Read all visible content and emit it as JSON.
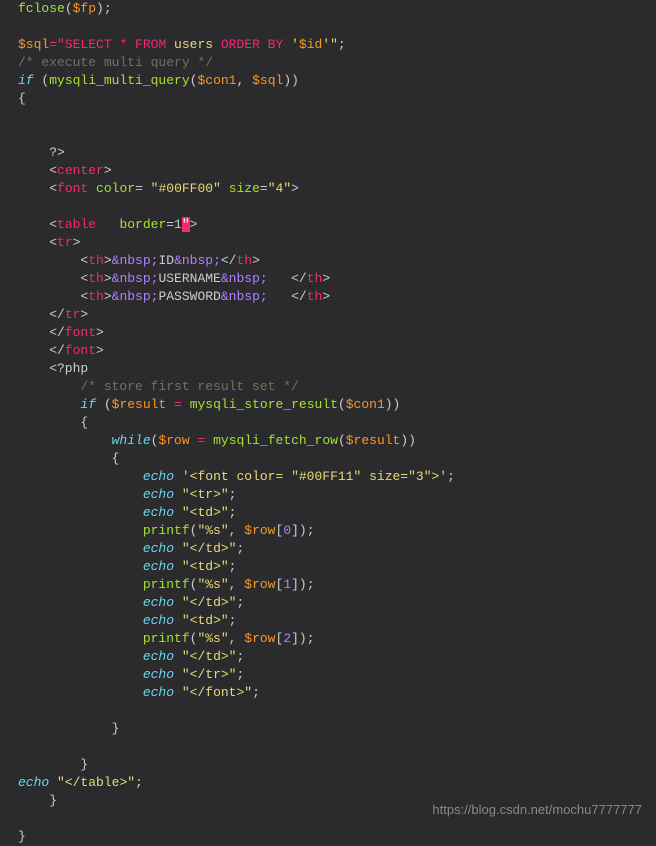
{
  "watermark": "https://blog.csdn.net/mochu7777777",
  "code": {
    "l01a": "fclose",
    "l01b": "(",
    "l01c": "$fp",
    "l01d": ");",
    "l03a": "$sql",
    "l03b": "=",
    "l03c": "\"SELECT * FROM",
    "l03d": " users ",
    "l03e": "ORDER BY",
    "l03f": " '",
    "l03g": "$id",
    "l03h": "'\"",
    "l03i": ";",
    "l04": "/* execute multi query */",
    "l05a": "if",
    "l05b": " (",
    "l05c": "mysqli_multi_query",
    "l05d": "(",
    "l05e": "$con1",
    "l05f": ", ",
    "l05g": "$sql",
    "l05h": "))",
    "l06": "{",
    "l09": "    ?>",
    "l10a": "    <",
    "l10b": "center",
    "l10c": ">",
    "l11a": "    <",
    "l11b": "font",
    "l11c": " ",
    "l11d": "color",
    "l11e": "= ",
    "l11f": "\"#00FF00\"",
    "l11g": " ",
    "l11h": "size",
    "l11i": "=",
    "l11j": "\"4\"",
    "l11k": ">",
    "l13a": "    <",
    "l13b": "table",
    "l13c": "   ",
    "l13d": "border",
    "l13e": "=1",
    "l13f": "\"",
    "l13g": ">",
    "l14a": "    <",
    "l14b": "tr",
    "l14c": ">",
    "l15a": "        <",
    "l15b": "th",
    "l15c": ">",
    "l15d": "&nbsp;",
    "l15e": "ID",
    "l15f": "&nbsp;",
    "l15g": "</",
    "l15h": "th",
    "l15i": ">",
    "l16a": "        <",
    "l16b": "th",
    "l16c": ">",
    "l16d": "&nbsp;",
    "l16e": "USERNAME",
    "l16f": "&nbsp;",
    "l16g": "   </",
    "l16h": "th",
    "l16i": ">",
    "l17a": "        <",
    "l17b": "th",
    "l17c": ">",
    "l17d": "&nbsp;",
    "l17e": "PASSWORD",
    "l17f": "&nbsp;",
    "l17g": "   </",
    "l17h": "th",
    "l17i": ">",
    "l18a": "    </",
    "l18b": "tr",
    "l18c": ">",
    "l19a": "    </",
    "l19b": "font",
    "l19c": ">",
    "l20a": "    </",
    "l20b": "font",
    "l20c": ">",
    "l21": "    <?php",
    "l22": "        /* store first result set */",
    "l23a": "        ",
    "l23b": "if",
    "l23c": " (",
    "l23d": "$result",
    "l23e": " ",
    "l23f": "=",
    "l23g": " ",
    "l23h": "mysqli_store_result",
    "l23i": "(",
    "l23j": "$con1",
    "l23k": "))",
    "l24": "        {",
    "l25a": "            ",
    "l25b": "while",
    "l25c": "(",
    "l25d": "$row",
    "l25e": " ",
    "l25f": "=",
    "l25g": " ",
    "l25h": "mysqli_fetch_row",
    "l25i": "(",
    "l25j": "$result",
    "l25k": "))",
    "l26": "            {",
    "l27a": "                ",
    "l27b": "echo",
    "l27c": " ",
    "l27d": "'<font color= \"#00FF11\" size=\"3\">'",
    "l27e": ";",
    "l28a": "                ",
    "l28b": "echo",
    "l28c": " ",
    "l28d": "\"<tr>\"",
    "l28e": ";",
    "l29a": "                ",
    "l29b": "echo",
    "l29c": " ",
    "l29d": "\"<td>\"",
    "l29e": ";",
    "l30a": "                ",
    "l30b": "printf",
    "l30c": "(",
    "l30d": "\"%s\"",
    "l30e": ", ",
    "l30f": "$row",
    "l30g": "[",
    "l30h": "0",
    "l30i": "]);",
    "l31a": "                ",
    "l31b": "echo",
    "l31c": " ",
    "l31d": "\"</td>\"",
    "l31e": ";",
    "l32a": "                ",
    "l32b": "echo",
    "l32c": " ",
    "l32d": "\"<td>\"",
    "l32e": ";",
    "l33a": "                ",
    "l33b": "printf",
    "l33c": "(",
    "l33d": "\"%s\"",
    "l33e": ", ",
    "l33f": "$row",
    "l33g": "[",
    "l33h": "1",
    "l33i": "]);",
    "l34a": "                ",
    "l34b": "echo",
    "l34c": " ",
    "l34d": "\"</td>\"",
    "l34e": ";",
    "l35a": "                ",
    "l35b": "echo",
    "l35c": " ",
    "l35d": "\"<td>\"",
    "l35e": ";",
    "l36a": "                ",
    "l36b": "printf",
    "l36c": "(",
    "l36d": "\"%s\"",
    "l36e": ", ",
    "l36f": "$row",
    "l36g": "[",
    "l36h": "2",
    "l36i": "]);",
    "l37a": "                ",
    "l37b": "echo",
    "l37c": " ",
    "l37d": "\"</td>\"",
    "l37e": ";",
    "l38a": "                ",
    "l38b": "echo",
    "l38c": " ",
    "l38d": "\"</tr>\"",
    "l38e": ";",
    "l39a": "                ",
    "l39b": "echo",
    "l39c": " ",
    "l39d": "\"</font>\"",
    "l39e": ";",
    "l41": "            }",
    "l43": "        }",
    "l44a": "echo",
    "l44b": " ",
    "l44c": "\"</table>\"",
    "l44d": ";",
    "l45": "    }",
    "l47": "}"
  }
}
